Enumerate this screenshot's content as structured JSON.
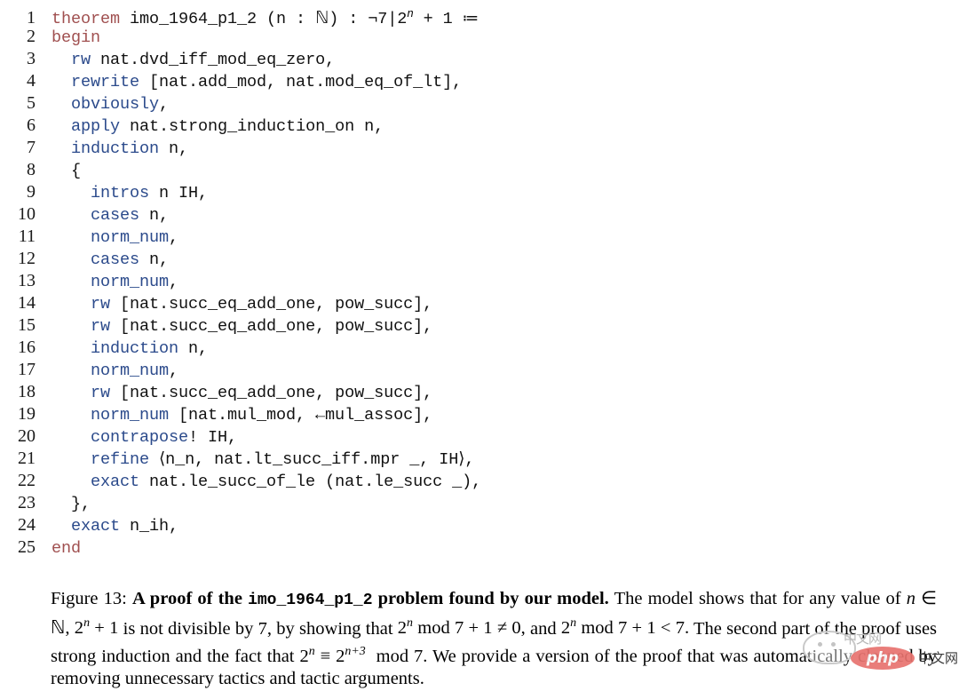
{
  "figure": {
    "code_language": "lean",
    "colors": {
      "keyword_declaration": "#a05050",
      "keyword_tactic": "#2b4a8b",
      "identifier": "#111111",
      "background": "#ffffff",
      "watermark_accent": "#e8736f"
    },
    "line_count": 25,
    "lines": [
      {
        "n": "1",
        "indent": 0,
        "tokens": [
          {
            "t": "theorem",
            "c": "kw-red"
          },
          {
            "t": " imo_1964_p1_2 (n : ",
            "c": "plain"
          },
          {
            "t": "ℕ",
            "c": "math-N"
          },
          {
            "t": ") : ¬7|2",
            "c": "plain"
          },
          {
            "t": "n",
            "c": "sup"
          },
          {
            "t": " + 1 ≔",
            "c": "plain"
          }
        ]
      },
      {
        "n": "2",
        "indent": 0,
        "tokens": [
          {
            "t": "begin",
            "c": "kw-red"
          }
        ]
      },
      {
        "n": "3",
        "indent": 1,
        "tokens": [
          {
            "t": "rw",
            "c": "kw-blue"
          },
          {
            "t": " nat.dvd_iff_mod_eq_zero,",
            "c": "plain"
          }
        ]
      },
      {
        "n": "4",
        "indent": 1,
        "tokens": [
          {
            "t": "rewrite",
            "c": "kw-blue"
          },
          {
            "t": " [nat.add_mod, nat.mod_eq_of_lt],",
            "c": "plain"
          }
        ]
      },
      {
        "n": "5",
        "indent": 1,
        "tokens": [
          {
            "t": "obviously",
            "c": "kw-blue"
          },
          {
            "t": ",",
            "c": "plain"
          }
        ]
      },
      {
        "n": "6",
        "indent": 1,
        "tokens": [
          {
            "t": "apply",
            "c": "kw-blue"
          },
          {
            "t": " nat.strong_induction_on n,",
            "c": "plain"
          }
        ]
      },
      {
        "n": "7",
        "indent": 1,
        "tokens": [
          {
            "t": "induction",
            "c": "kw-blue"
          },
          {
            "t": " n,",
            "c": "plain"
          }
        ]
      },
      {
        "n": "8",
        "indent": 1,
        "tokens": [
          {
            "t": "{",
            "c": "plain"
          }
        ]
      },
      {
        "n": "9",
        "indent": 2,
        "tokens": [
          {
            "t": "intros",
            "c": "kw-blue"
          },
          {
            "t": " n IH,",
            "c": "plain"
          }
        ]
      },
      {
        "n": "10",
        "indent": 2,
        "tokens": [
          {
            "t": "cases",
            "c": "kw-blue"
          },
          {
            "t": " n,",
            "c": "plain"
          }
        ]
      },
      {
        "n": "11",
        "indent": 2,
        "tokens": [
          {
            "t": "norm_num",
            "c": "kw-blue"
          },
          {
            "t": ",",
            "c": "plain"
          }
        ]
      },
      {
        "n": "12",
        "indent": 2,
        "tokens": [
          {
            "t": "cases",
            "c": "kw-blue"
          },
          {
            "t": " n,",
            "c": "plain"
          }
        ]
      },
      {
        "n": "13",
        "indent": 2,
        "tokens": [
          {
            "t": "norm_num",
            "c": "kw-blue"
          },
          {
            "t": ",",
            "c": "plain"
          }
        ]
      },
      {
        "n": "14",
        "indent": 2,
        "tokens": [
          {
            "t": "rw",
            "c": "kw-blue"
          },
          {
            "t": " [nat.succ_eq_add_one, pow_succ],",
            "c": "plain"
          }
        ]
      },
      {
        "n": "15",
        "indent": 2,
        "tokens": [
          {
            "t": "rw",
            "c": "kw-blue"
          },
          {
            "t": " [nat.succ_eq_add_one, pow_succ],",
            "c": "plain"
          }
        ]
      },
      {
        "n": "16",
        "indent": 2,
        "tokens": [
          {
            "t": "induction",
            "c": "kw-blue"
          },
          {
            "t": " n,",
            "c": "plain"
          }
        ]
      },
      {
        "n": "17",
        "indent": 2,
        "tokens": [
          {
            "t": "norm_num",
            "c": "kw-blue"
          },
          {
            "t": ",",
            "c": "plain"
          }
        ]
      },
      {
        "n": "18",
        "indent": 2,
        "tokens": [
          {
            "t": "rw",
            "c": "kw-blue"
          },
          {
            "t": " [nat.succ_eq_add_one, pow_succ],",
            "c": "plain"
          }
        ]
      },
      {
        "n": "19",
        "indent": 2,
        "tokens": [
          {
            "t": "norm_num",
            "c": "kw-blue"
          },
          {
            "t": " [nat.mul_mod, ←mul_assoc],",
            "c": "plain"
          }
        ]
      },
      {
        "n": "20",
        "indent": 2,
        "tokens": [
          {
            "t": "contrapose",
            "c": "kw-blue"
          },
          {
            "t": "! IH,",
            "c": "plain"
          }
        ]
      },
      {
        "n": "21",
        "indent": 2,
        "tokens": [
          {
            "t": "refine",
            "c": "kw-blue"
          },
          {
            "t": " ⟨n_n, nat.lt_succ_iff.mpr _, IH⟩,",
            "c": "plain"
          }
        ]
      },
      {
        "n": "22",
        "indent": 2,
        "tokens": [
          {
            "t": "exact",
            "c": "kw-blue"
          },
          {
            "t": " nat.le_succ_of_le (nat.le_succ _),",
            "c": "plain"
          }
        ]
      },
      {
        "n": "23",
        "indent": 1,
        "tokens": [
          {
            "t": "},",
            "c": "plain"
          }
        ]
      },
      {
        "n": "24",
        "indent": 1,
        "tokens": [
          {
            "t": "exact",
            "c": "kw-blue"
          },
          {
            "t": " n_ih,",
            "c": "plain"
          }
        ]
      },
      {
        "n": "25",
        "indent": 0,
        "tokens": [
          {
            "t": "end",
            "c": "kw-red"
          }
        ]
      }
    ]
  },
  "caption": {
    "label": "Figure 13:",
    "bold_title_part1": "A proof of the",
    "bold_title_mono": "imo_1964_p1_2",
    "bold_title_part2": "problem found by our model.",
    "body_1": "The model shows that for any value of",
    "math_1": "n ∈ ℕ, 2ⁿ + 1",
    "body_2": "is not divisible by 7, by showing that",
    "math_2": "2ⁿ mod 7 + 1 ≠ 0,",
    "body_3": "and",
    "math_3": "2ⁿ mod 7 + 1 < 7.",
    "body_4": "The second part of the proof uses strong induction and the fact that",
    "math_4": "2ⁿ ≡ 2ⁿ⁺³ mod 7.",
    "body_5": "We provide a version of the proof that was automatically cleaned by removing unnecessary tactics and tactic arguments."
  },
  "watermark": {
    "brand": "php",
    "suffix": "中文网",
    "faded_text": "中文网"
  }
}
